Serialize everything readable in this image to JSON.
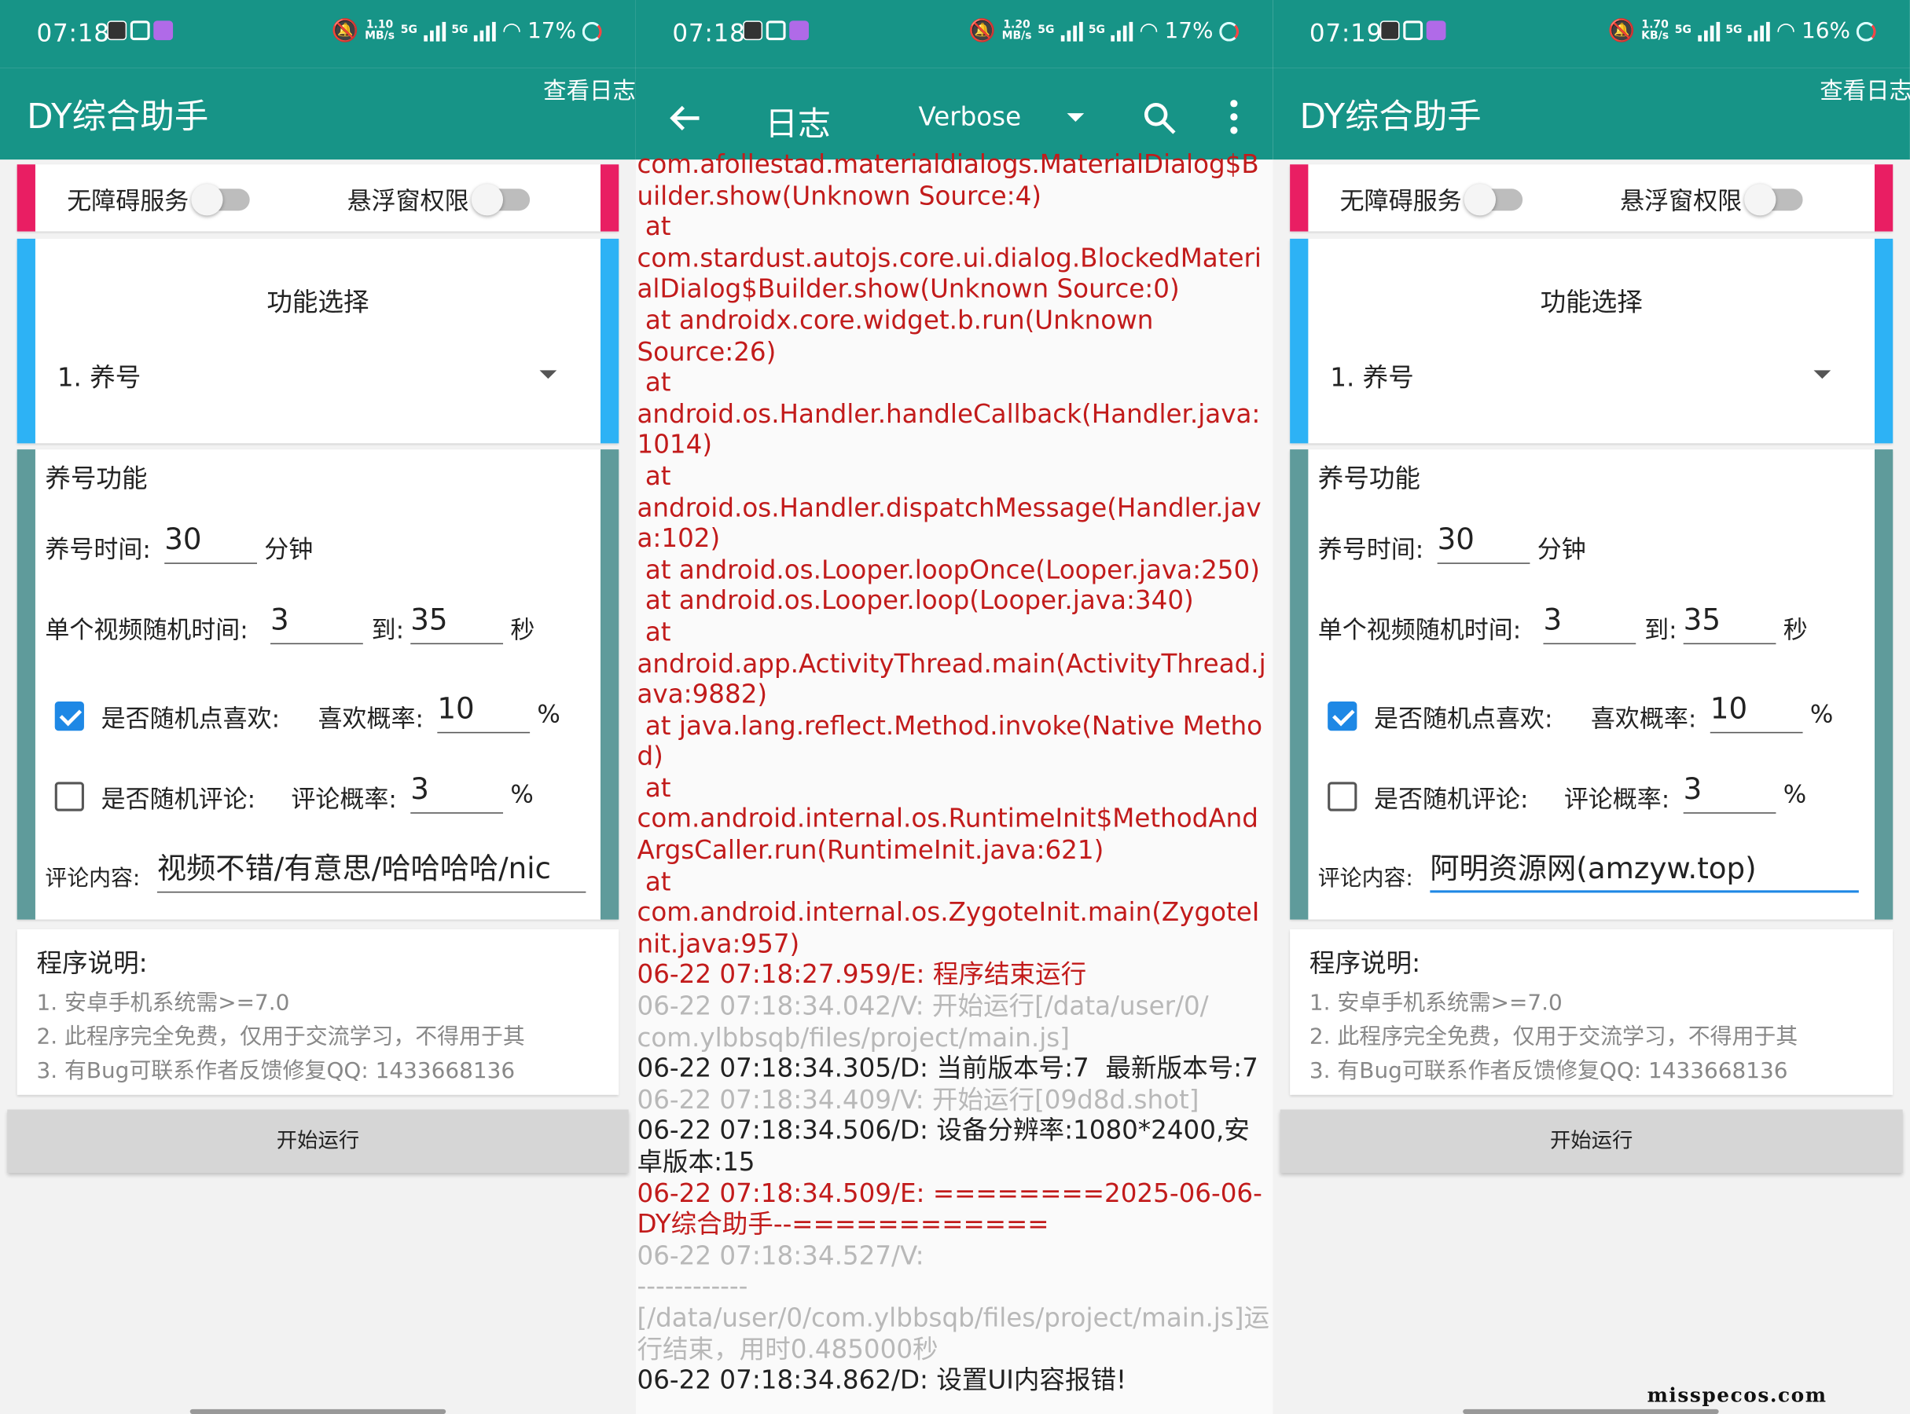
{
  "screen1": {
    "status": {
      "time": "07:18",
      "netspeed_value": "1.10",
      "netspeed_unit": "MB/s",
      "network": "5G",
      "battery": "17%"
    },
    "app_title": "DY综合助手",
    "log_link": "查看日志",
    "perm": {
      "accessibility_label": "无障碍服务",
      "accessibility_on": false,
      "overlay_label": "悬浮窗权限",
      "overlay_on": false
    },
    "func": {
      "title": "功能选择",
      "selected": "1. 养号"
    },
    "form": {
      "title": "养号功能",
      "time_label": "养号时间:",
      "time_value": "30",
      "time_unit": "分钟",
      "rand_label": "单个视频随机时间:",
      "rand_from": "3",
      "rand_to_label": "到:",
      "rand_to": "35",
      "rand_unit": "秒",
      "like_label": "是否随机点喜欢:",
      "like_checked": true,
      "like_prob_label": "喜欢概率:",
      "like_prob": "10",
      "like_unit": "%",
      "comment_label": "是否随机评论:",
      "comment_checked": false,
      "comment_prob_label": "评论概率:",
      "comment_prob": "3",
      "comment_unit": "%",
      "content_label": "评论内容:",
      "content_value": "视频不错/有意思/哈哈哈哈/nic"
    },
    "notes": {
      "title": "程序说明:",
      "lines": [
        "1. 安卓手机系统需>=7.0",
        "2. 此程序完全免费，仅用于交流学习，不得用于其",
        "3. 有Bug可联系作者反馈修复QQ: 1433668136"
      ]
    },
    "start_button": "开始运行"
  },
  "screen2": {
    "status": {
      "time": "07:18",
      "netspeed_value": "1.20",
      "netspeed_unit": "MB/s",
      "network": "5G",
      "battery": "17%"
    },
    "title": "日志",
    "level": "Verbose",
    "icons": {
      "back": "arrow-back-icon",
      "search": "search-icon",
      "more": "more-vert-icon"
    },
    "colors": {
      "error": "#c21b1b",
      "verbose": "#b8b8b8",
      "debug": "#222222"
    },
    "log_lines": [
      {
        "level": "E",
        "text": "com.afollestad.materialdialogs.MaterialDialog$Builder.show(Unknown Source:4)"
      },
      {
        "level": "E",
        "text": " at\ncom.stardust.autojs.core.ui.dialog.BlockedMaterialDialog$Builder.show(Unknown Source:0)"
      },
      {
        "level": "E",
        "text": " at androidx.core.widget.b.run(Unknown\nSource:26)"
      },
      {
        "level": "E",
        "text": " at\nandroid.os.Handler.handleCallback(Handler.java:1014)"
      },
      {
        "level": "E",
        "text": " at\nandroid.os.Handler.dispatchMessage(Handler.java:102)"
      },
      {
        "level": "E",
        "text": " at android.os.Looper.loopOnce(Looper.java:250)"
      },
      {
        "level": "E",
        "text": " at android.os.Looper.loop(Looper.java:340)"
      },
      {
        "level": "E",
        "text": " at\nandroid.app.ActivityThread.main(ActivityThread.java:9882)"
      },
      {
        "level": "E",
        "text": " at java.lang.reflect.Method.invoke(Native Method)"
      },
      {
        "level": "E",
        "text": " at\ncom.android.internal.os.RuntimeInit$MethodAndArgsCaller.run(RuntimeInit.java:621)"
      },
      {
        "level": "E",
        "text": " at\ncom.android.internal.os.ZygoteInit.main(ZygoteInit.java:957)"
      },
      {
        "level": "E",
        "text": "06-22 07:18:27.959/E: 程序结束运行"
      },
      {
        "level": "V",
        "text": "06-22 07:18:34.042/V: 开始运行[/data/user/0/\ncom.ylbbsqb/files/project/main.js]"
      },
      {
        "level": "D",
        "text": "06-22 07:18:34.305/D: 当前版本号:7  最新版本号:7"
      },
      {
        "level": "V",
        "text": "06-22 07:18:34.409/V: 开始运行[09d8d.shot]"
      },
      {
        "level": "D",
        "text": "06-22 07:18:34.506/D: 设备分辨率:1080*2400,安卓版本:15"
      },
      {
        "level": "E",
        "text": "06-22 07:18:34.509/E: ========2025-06-06-DY综合助手--============"
      },
      {
        "level": "V",
        "text": "06-22 07:18:34.527/V:\n------------\n[/data/user/0/com.ylbbsqb/files/project/main.js]运行结束，用时0.485000秒"
      },
      {
        "level": "D",
        "text": "06-22 07:18:34.862/D: 设置UI内容报错!"
      }
    ]
  },
  "screen3": {
    "status": {
      "time": "07:19",
      "netspeed_value": "1.70",
      "netspeed_unit": "KB/s",
      "network": "5G",
      "battery": "16%"
    },
    "app_title": "DY综合助手",
    "log_link": "查看日志",
    "perm": {
      "accessibility_label": "无障碍服务",
      "accessibility_on": false,
      "overlay_label": "悬浮窗权限",
      "overlay_on": false
    },
    "func": {
      "title": "功能选择",
      "selected": "1. 养号"
    },
    "form": {
      "title": "养号功能",
      "time_label": "养号时间:",
      "time_value": "30",
      "time_unit": "分钟",
      "rand_label": "单个视频随机时间:",
      "rand_from": "3",
      "rand_to_label": "到:",
      "rand_to": "35",
      "rand_unit": "秒",
      "like_label": "是否随机点喜欢:",
      "like_checked": true,
      "like_prob_label": "喜欢概率:",
      "like_prob": "10",
      "like_unit": "%",
      "comment_label": "是否随机评论:",
      "comment_checked": false,
      "comment_prob_label": "评论概率:",
      "comment_prob": "3",
      "comment_unit": "%",
      "content_label": "评论内容:",
      "content_value": "阿明资源网(amzyw.top)"
    },
    "notes": {
      "title": "程序说明:",
      "lines": [
        "1. 安卓手机系统需>=7.0",
        "2. 此程序完全免费，仅用于交流学习，不得用于其",
        "3. 有Bug可联系作者反馈修复QQ: 1433668136"
      ]
    },
    "start_button": "开始运行",
    "watermark": "misspecos.com"
  },
  "theme": {
    "primary": "#179487",
    "perm_accent": "#e91e63",
    "func_accent": "#2db2f5",
    "form_accent": "#5f9b9b",
    "checkbox": "#1e88e5"
  }
}
